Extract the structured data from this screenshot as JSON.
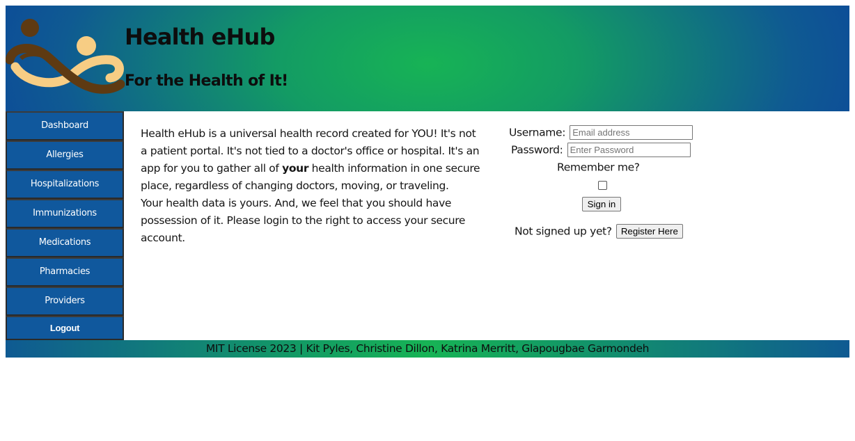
{
  "header": {
    "title": "Health eHub",
    "tagline": "For the Health of It!",
    "logo_icon": "infinity-people-logo"
  },
  "sidebar": {
    "items": [
      {
        "label": "Dashboard"
      },
      {
        "label": "Allergies"
      },
      {
        "label": "Hospitalizations"
      },
      {
        "label": "Immunizations"
      },
      {
        "label": "Medications"
      },
      {
        "label": "Pharmacies"
      },
      {
        "label": "Providers"
      },
      {
        "label": "Logout"
      }
    ]
  },
  "intro": {
    "p1_before": "Health eHub is a universal health record created for YOU! It's not a patient portal. It's not tied to a doctor's office or hospital. It's an app for you to gather all of ",
    "p1_bold": "your",
    "p1_after": " health information in one secure place, regardless of changing doctors, moving, or traveling.",
    "p2": "Your health data is yours. And, we feel that you should have possession of it. Please login to the right to access your secure account."
  },
  "login": {
    "username_label": "Username:",
    "username_placeholder": "Email address",
    "password_label": "Password:",
    "password_placeholder": "Enter Password",
    "remember_label": "Remember me?",
    "remember_checked": false,
    "signin_label": "Sign in",
    "not_signed_up": "Not signed up yet?",
    "register_label": "Register Here"
  },
  "footer": {
    "text": "MIT License 2023 | Kit Pyles, Christine Dillon, Katrina Merritt, Glapougbae Garmondeh"
  },
  "colors": {
    "nav_bg": "#10589d",
    "header_green": "#17b355",
    "header_blue": "#0d4f97",
    "logo_brown": "#5e3a12",
    "logo_tan": "#f7cd84"
  }
}
